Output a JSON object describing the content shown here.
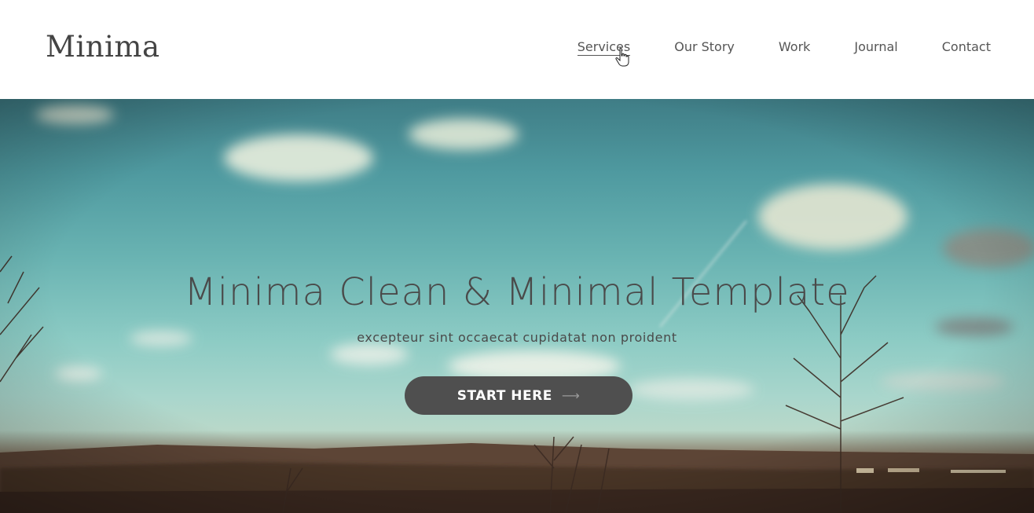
{
  "brand": {
    "name": "Minima"
  },
  "nav": {
    "items": [
      {
        "label": "Services",
        "active": true
      },
      {
        "label": "Our Story",
        "active": false
      },
      {
        "label": "Work",
        "active": false
      },
      {
        "label": "Journal",
        "active": false
      },
      {
        "label": "Contact",
        "active": false
      }
    ]
  },
  "hero": {
    "title": "Minima Clean & Minimal Template",
    "subtitle": "excepteur sint occaecat cupidatat non proident",
    "cta_label": "START HERE",
    "cta_icon": "arrow-right-icon"
  },
  "colors": {
    "accent": "#4f4f4f",
    "text": "#4a4a4a",
    "sky_top": "#3f7d86",
    "sky_bottom": "#b9d8c9",
    "ground": "#3f2e24"
  },
  "cursor": {
    "icon": "hand-pointer-icon"
  }
}
